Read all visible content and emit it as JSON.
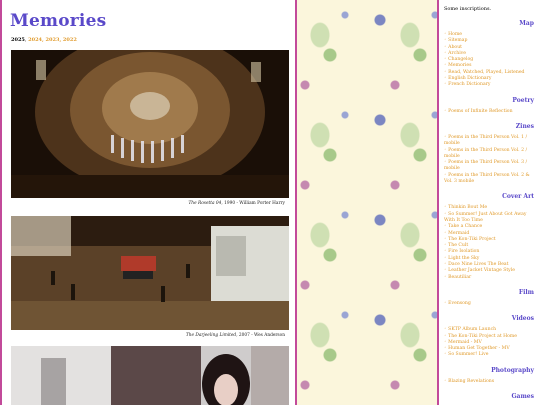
{
  "page": {
    "title": "Memories",
    "years": {
      "current": "2025",
      "links": [
        "2024",
        "2023",
        "2022"
      ]
    }
  },
  "photos": [
    {
      "caption_title": "The Rosetta 04",
      "caption_rest": ", 1990 - William Porter Harry"
    },
    {
      "caption_title": "The Darjeeling Limited",
      "caption_rest": ", 2007 - Wes Anderson"
    },
    {
      "caption_title": "",
      "caption_rest": ""
    }
  ],
  "sidebar": {
    "intro": "Some inscriptions.",
    "sections": [
      {
        "heading": "Map",
        "items": [
          "Home",
          "Sitemap",
          "About",
          "Archive",
          "Changelog",
          "Memories",
          "Read, Watched, Played, Listened",
          "English Dictionary",
          "French Dictionary"
        ]
      },
      {
        "heading": "Poetry",
        "items": [
          "Poems of Infinite Reflection"
        ]
      },
      {
        "heading": "Zines",
        "items": [
          "Poems in the Third Person Vol. 1 / mobile",
          "Poems in the Third Person Vol. 2 / mobile",
          "Poems in the Third Person Vol. 3 / mobile",
          "Poems in the Third Person Vol. 2 & Vol. 3 mobile"
        ]
      },
      {
        "heading": "Cover Art",
        "items": [
          "Thinkin Bout Me",
          "So Summer! Just About Got Away With It Too Time",
          "Take a Chance",
          "Mermaid",
          "The Kon-Tiki Project",
          "The Cult",
          "Fire Isolation",
          "Light the Sky",
          "Dace Nine Lives The Beat",
          "Leather Jacket Vintage Style",
          "Beautiliar"
        ]
      },
      {
        "heading": "Film",
        "items": [
          "Evensong"
        ]
      },
      {
        "heading": "Videos",
        "items": [
          "SKTP Album Launch",
          "The Kon-Tiki Project at Home",
          "Mermaid - MV",
          "Human Get Together - MV",
          "So Summer! Live"
        ]
      },
      {
        "heading": "Photography",
        "items": [
          "Blazing Revelations"
        ]
      },
      {
        "heading": "Games",
        "items": []
      }
    ]
  },
  "colors": {
    "accent": "#5a49c9",
    "link": "#e09a2b",
    "border": "#c24a9a"
  }
}
